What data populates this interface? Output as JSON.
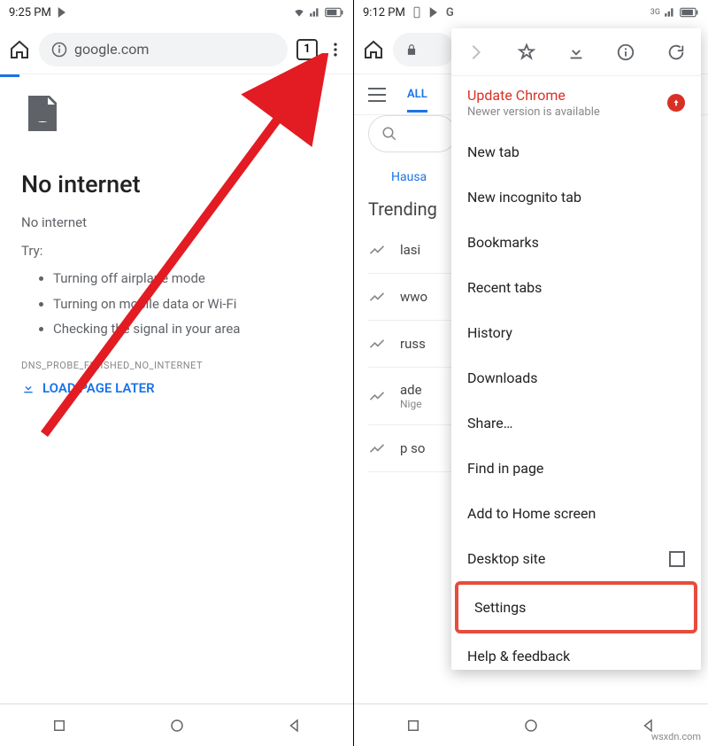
{
  "left": {
    "time": "9:25 PM",
    "url": "google.com",
    "tab_count": "1",
    "heading": "No internet",
    "subheading": "No internet",
    "try_label": "Try:",
    "tips": [
      "Turning off airplane mode",
      "Turning on mobile data or Wi-Fi",
      "Checking the signal in your area"
    ],
    "error_code": "DNS_PROBE_FINISHED_NO_INTERNET",
    "load_later": "LOAD PAGE LATER"
  },
  "right": {
    "time": "9:12 PM",
    "tab_all": "ALL",
    "hausa": "Hausa",
    "trending": "Trending",
    "trends": [
      {
        "t": "lasi"
      },
      {
        "t": "wwo"
      },
      {
        "t": "russ"
      },
      {
        "t": "ade",
        "s": "Nige"
      },
      {
        "t": "p so"
      }
    ],
    "menu": {
      "update_title": "Update Chrome",
      "update_sub": "Newer version is available",
      "items": [
        "New tab",
        "New incognito tab",
        "Bookmarks",
        "Recent tabs",
        "History",
        "Downloads",
        "Share…",
        "Find in page",
        "Add to Home screen"
      ],
      "desktop": "Desktop site",
      "settings": "Settings",
      "help": "Help & feedback"
    }
  },
  "watermark": "wsxdn.com"
}
